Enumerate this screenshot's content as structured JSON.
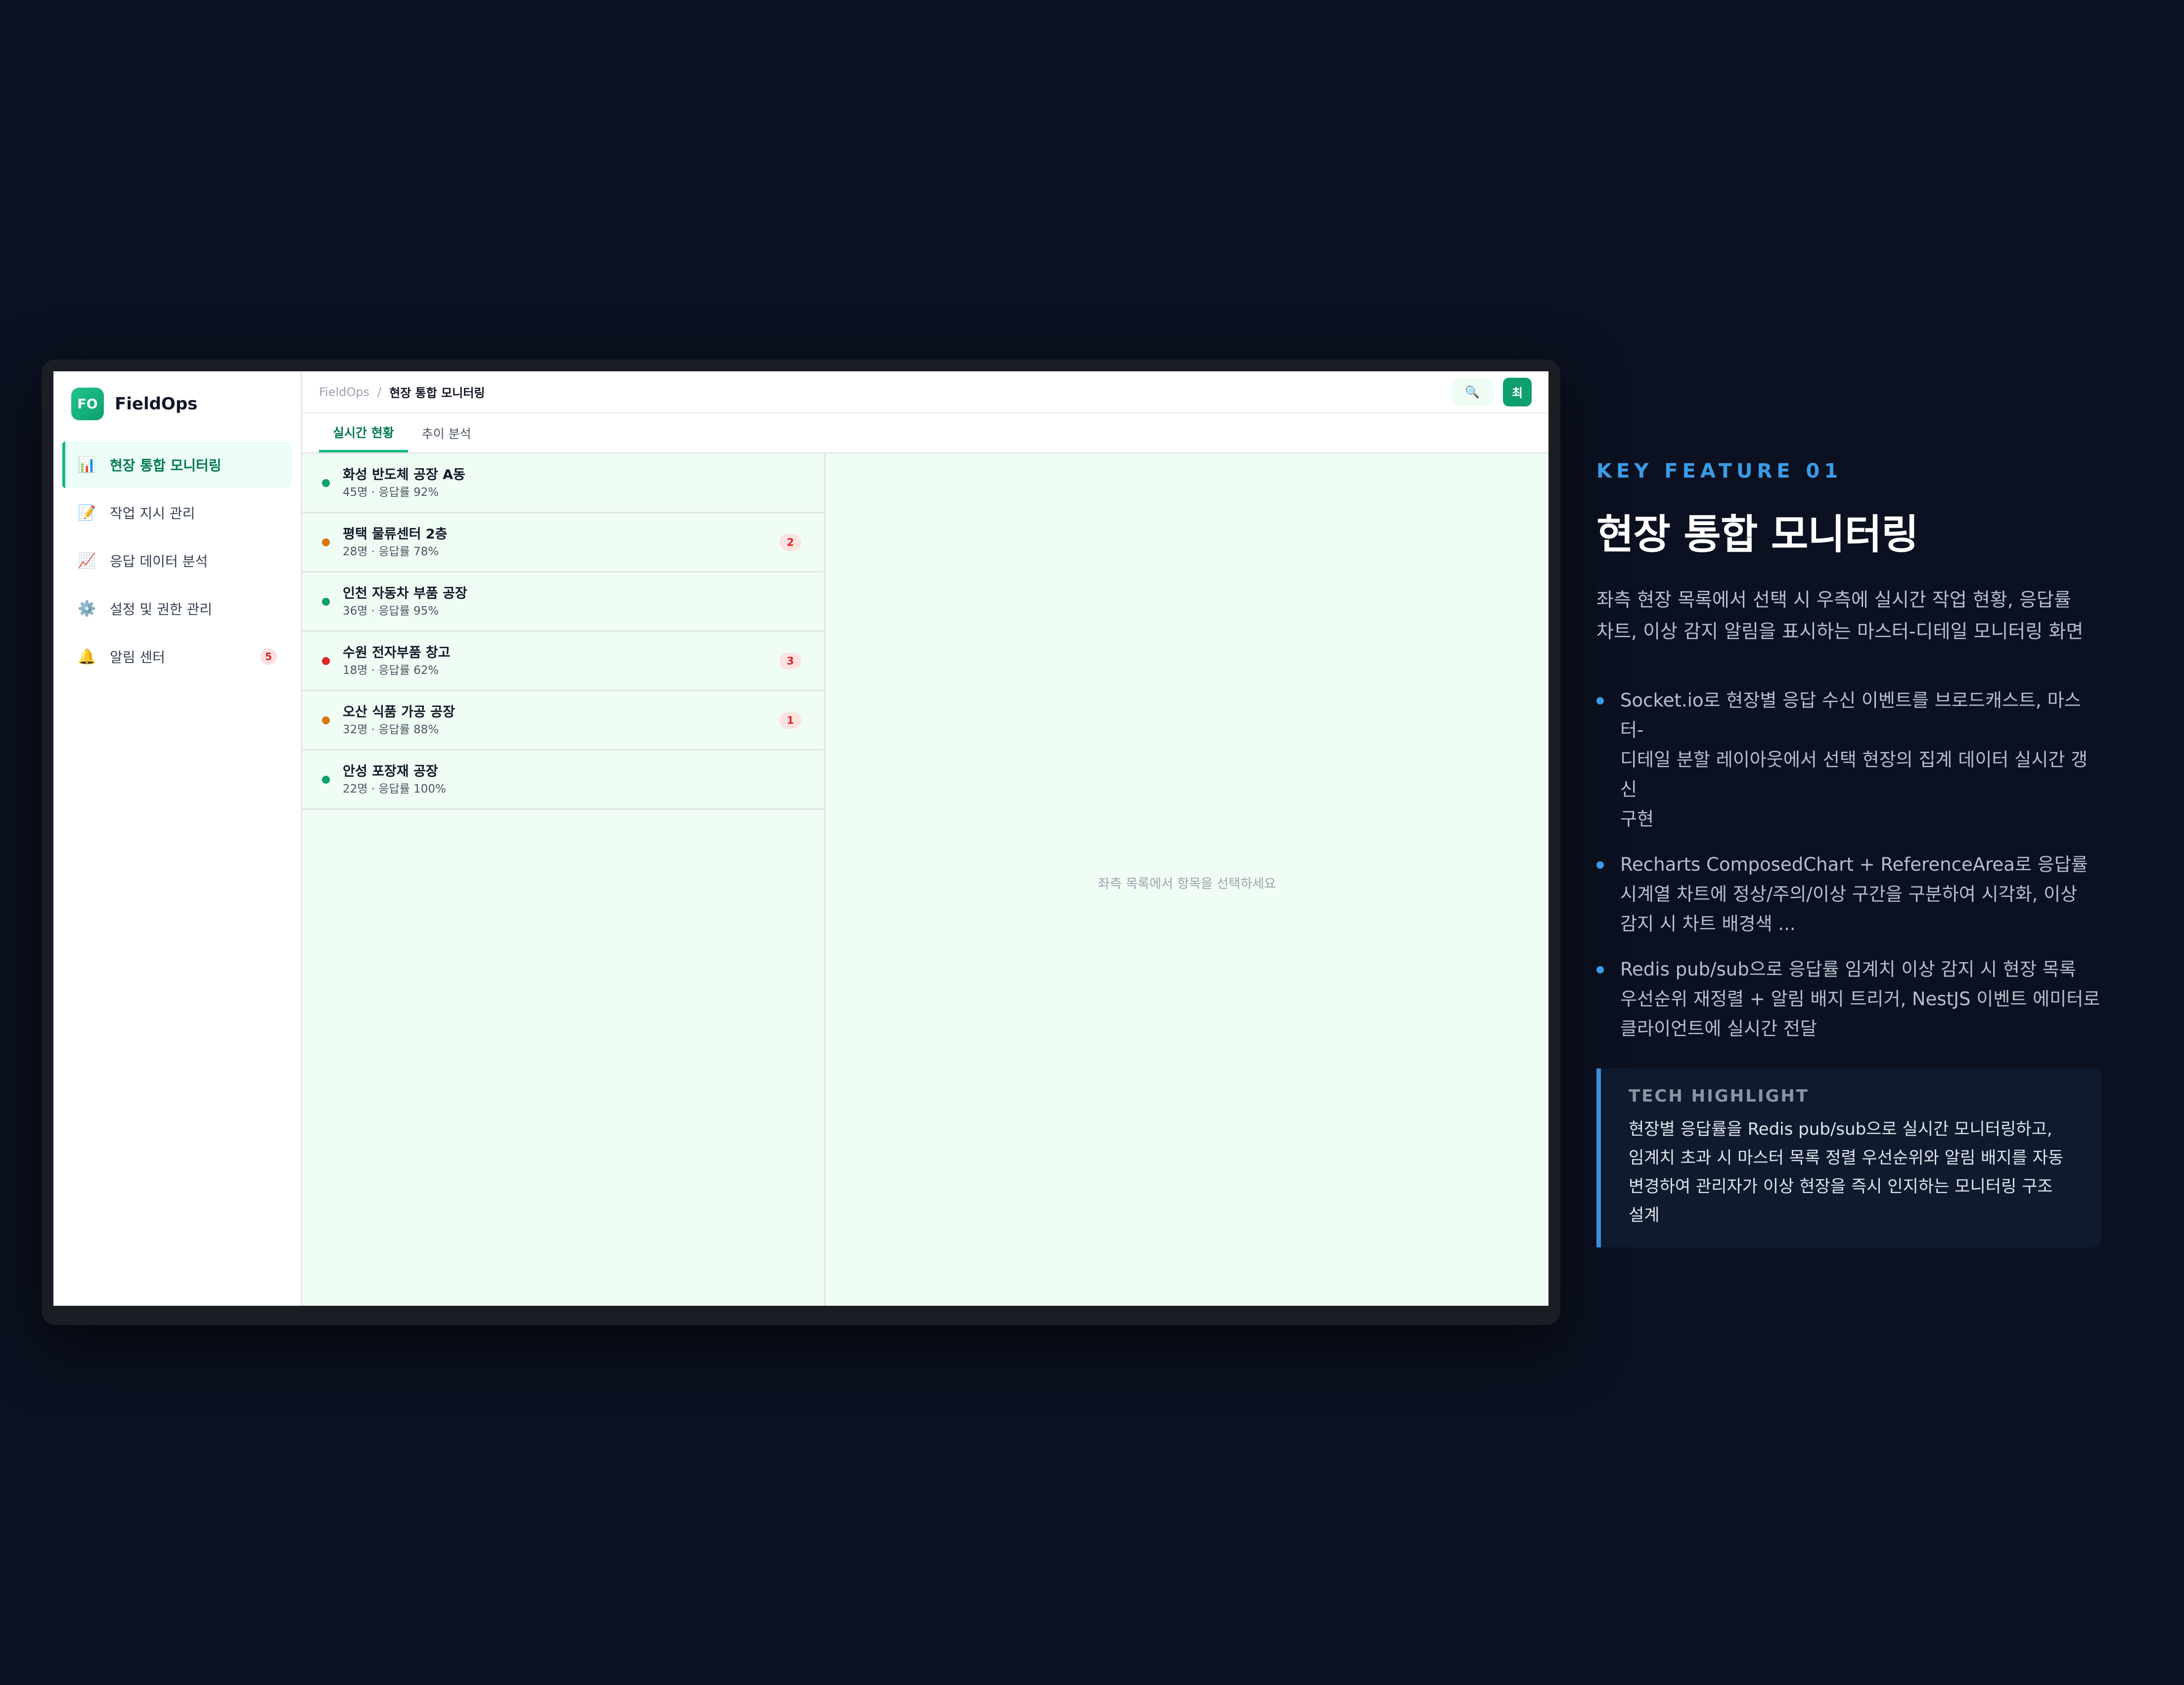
{
  "app": {
    "brand_short": "FO",
    "brand_name": "FieldOps"
  },
  "sidebar": {
    "items": [
      {
        "icon": "📊",
        "icon_name": "bar-chart-icon",
        "label": "현장 통합 모니터링",
        "active": true
      },
      {
        "icon": "📝",
        "icon_name": "memo-icon",
        "label": "작업 지시 관리"
      },
      {
        "icon": "📈",
        "icon_name": "trend-chart-icon",
        "label": "응답 데이터 분석"
      },
      {
        "icon": "⚙️",
        "icon_name": "gear-icon",
        "label": "설정 및 권한 관리"
      },
      {
        "icon": "🔔",
        "icon_name": "bell-icon",
        "label": "알림 센터",
        "badge": "5"
      }
    ]
  },
  "header": {
    "breadcrumb_root": "FieldOps",
    "breadcrumb_sep": "/",
    "breadcrumb_current": "현장 통합 모니터링",
    "search_icon": "🔍",
    "avatar": "최"
  },
  "tabs": [
    {
      "label": "실시간 현황",
      "active": true
    },
    {
      "label": "추이 분석"
    }
  ],
  "status_colors": {
    "normal": "#0e9f6e",
    "warning": "#d97706",
    "critical": "#dc2626"
  },
  "sites": [
    {
      "name": "화성 반도체 공장 A동",
      "meta": "45명 · 응답률 92%",
      "status": "normal"
    },
    {
      "name": "평택 물류센터 2층",
      "meta": "28명 · 응답률 78%",
      "status": "warning",
      "alerts": "2"
    },
    {
      "name": "인천 자동차 부품 공장",
      "meta": "36명 · 응답률 95%",
      "status": "normal"
    },
    {
      "name": "수원 전자부품 창고",
      "meta": "18명 · 응답률 62%",
      "status": "critical",
      "alerts": "3"
    },
    {
      "name": "오산 식품 가공 공장",
      "meta": "32명 · 응답률 88%",
      "status": "warning",
      "alerts": "1"
    },
    {
      "name": "안성 포장재 공장",
      "meta": "22명 · 응답률 100%",
      "status": "normal"
    }
  ],
  "detail": {
    "empty_message": "좌측 목록에서 항목을 선택하세요"
  },
  "feature": {
    "kicker": "KEY FEATURE 01",
    "title": "현장 통합 모니터링",
    "description_lines": [
      "좌측 현장 목록에서 선택 시 우측에 실시간 작업 현황, 응답률",
      "차트, 이상 감지 알림을 표시하는 마스터-디테일 모니터링 화면"
    ],
    "bullets": [
      {
        "lines": [
          "Socket.io로 현장별 응답 수신 이벤트를 브로드캐스트, 마스터-",
          "디테일 분할 레이아웃에서 선택 현장의 집계 데이터 실시간 갱신",
          "구현"
        ]
      },
      {
        "lines": [
          "Recharts ComposedChart + ReferenceArea로 응답률",
          "시계열 차트에 정상/주의/이상 구간을 구분하여 시각화, 이상",
          "감지 시 차트 배경색 ..."
        ]
      },
      {
        "lines": [
          "Redis pub/sub으로 응답률 임계치 이상 감지 시 현장 목록",
          "우선순위 재정렬 + 알림 배지 트리거, NestJS 이벤트 에미터로",
          "클라이언트에 실시간 전달"
        ]
      }
    ],
    "highlight_title": "TECH HIGHLIGHT",
    "highlight_lines": [
      "현장별 응답률을 Redis pub/sub으로 실시간 모니터링하고,",
      "임계치 초과 시 마스터 목록 정렬 우선순위와 알림 배지를 자동",
      "변경하여 관리자가 이상 현장을 즉시 인지하는 모니터링 구조",
      "설계"
    ]
  }
}
